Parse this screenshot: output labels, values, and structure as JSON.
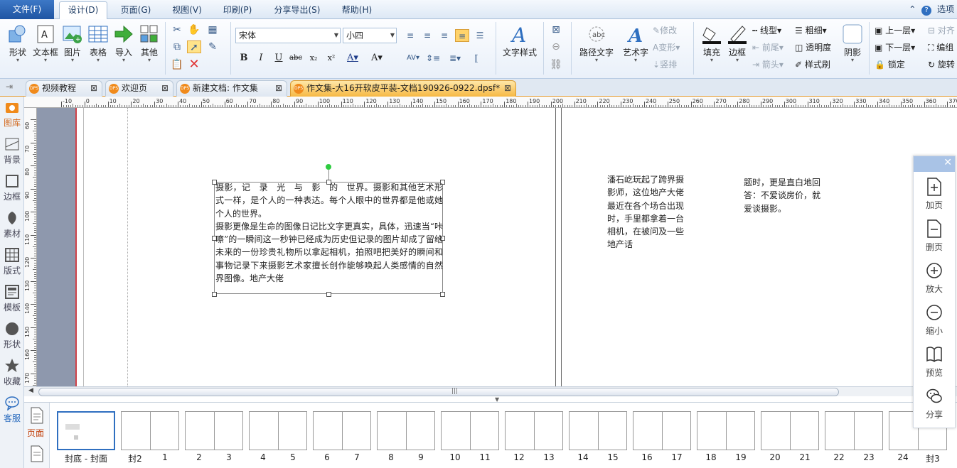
{
  "menubar": {
    "file": "文件(F)",
    "tabs": [
      "设计(D)",
      "页面(G)",
      "视图(V)",
      "印刷(P)",
      "分享导出(S)",
      "帮助(H)"
    ],
    "right": {
      "options": "选项"
    }
  },
  "ribbon": {
    "shape": "形状",
    "textbox": "文本框",
    "picture": "图片",
    "table": "表格",
    "import": "导入",
    "other": "其他",
    "font_name": "宋体",
    "font_size": "小四",
    "text_style": "文字样式",
    "path_text": "路径文字",
    "art_text": "艺术字",
    "modify": "修改",
    "deform": "变形",
    "vertical": "竖排",
    "fill": "填充",
    "border": "边框",
    "line_type": "线型",
    "front_arrow": "前尾",
    "arrow": "箭头",
    "bold_line": "粗细",
    "transparency": "透明度",
    "style_brush": "样式刷",
    "shadow": "阴影",
    "bring_forward": "上一层",
    "send_backward": "下一层",
    "lock": "锁定",
    "align": "对齐",
    "group": "编组",
    "rotate": "旋转"
  },
  "doctabs": [
    {
      "label": "视频教程"
    },
    {
      "label": "欢迎页"
    },
    {
      "label": "新建文档: 作文集"
    },
    {
      "label": "作文集-大16开软皮平装-文档190926-0922.dpsf*"
    }
  ],
  "sidebar": [
    "图库",
    "背景",
    "边框",
    "素材",
    "版式",
    "模板",
    "形状",
    "收藏",
    "客服"
  ],
  "ruler": {
    "h_labels": [
      "-10",
      "0",
      "10",
      "20",
      "30",
      "40",
      "50",
      "60",
      "70",
      "80",
      "90",
      "100",
      "110",
      "120",
      "130",
      "140",
      "150",
      "160",
      "170",
      "180",
      "190",
      "200",
      "210",
      "220",
      "230",
      "240",
      "250",
      "260",
      "270",
      "280",
      "290",
      "300",
      "310",
      "320",
      "330",
      "340",
      "350",
      "360",
      "370",
      "380"
    ],
    "v_labels": [
      "60",
      "70",
      "80",
      "90",
      "100",
      "110",
      "120",
      "130",
      "140",
      "150",
      "160",
      "170"
    ]
  },
  "document": {
    "textbox_text": "摄影，记　录　光　与　影　的　世界。摄影和其他艺术形式一样，是个人的一种表达。每个人眼中的世界都是他或她个人的世界。\n摄影更像是生命的图像日记比文字更真实，具体，迅速当“咔嚓”的一瞬间这一秒钟已经成为历史但记录的图片却成了留给未来的一份珍贵礼物所以拿起相机，拍照吧把美好的瞬间和事物记录下来摄影艺术家擅长创作能够唤起人类感情的自然界图像。地产大佬",
    "col1_text": "潘石屹玩起了跨界摄影师，这位地产大佬最近在各个场合出现时，手里都拿着一台相机，在被问及一些地产话",
    "col2_text": "题时，更是直白地回答：不爱谈房价，就爱谈摄影。"
  },
  "pages": {
    "side_label": "页面",
    "labels": [
      "封底 - 封面",
      "封2",
      "1",
      "2",
      "3",
      "4",
      "5",
      "6",
      "7",
      "8",
      "9",
      "10",
      "11",
      "12",
      "13",
      "14",
      "15",
      "16",
      "17",
      "18",
      "19",
      "20",
      "21",
      "22",
      "23",
      "24",
      "封3"
    ]
  },
  "float_panel": [
    "加页",
    "删页",
    "放大",
    "缩小",
    "预览",
    "分享"
  ]
}
